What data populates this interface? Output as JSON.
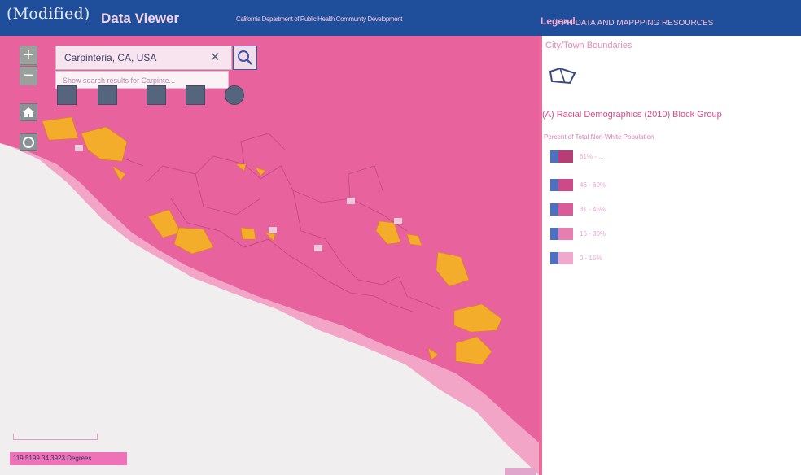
{
  "header": {
    "watermark": "(Modified)",
    "app_title": "Data Viewer",
    "agency": "California Department of Public Health Community Development",
    "legend_label": "Legend",
    "resources_label": "PH DATA AND MAPPPING RESOURCES"
  },
  "map": {
    "zoom_in_label": "+",
    "zoom_out_label": "−",
    "search": {
      "value": "Carpinteria, CA, USA",
      "clear_label": "✕",
      "suggestion": "Show search results for Carpinte..."
    },
    "coords_text": "119.5199 34.3923 Degrees"
  },
  "legend": {
    "city_layer": "City/Town Boundaries",
    "demographics_layer": "(A) Racial Demographics (2010) Block Group",
    "field_label": "Percent of Total Non-White Population",
    "classes": [
      {
        "label": "61% - ...",
        "color": "#b63d76"
      },
      {
        "label": "46 - 60%",
        "color": "#cd4a89"
      },
      {
        "label": "31 - 45%",
        "color": "#db5b98"
      },
      {
        "label": "16 - 30%",
        "color": "#e77eb2"
      },
      {
        "label": "0 - 15%",
        "color": "#f0a9cc"
      }
    ]
  },
  "colors": {
    "header_bg": "#1f4f9a",
    "map_fill": "#e8629d",
    "city_fill": "#f4ad2b",
    "panel_border": "#e86b9a"
  },
  "icons": {
    "home": "home-icon",
    "locate": "locate-icon",
    "search": "search-icon",
    "legend_polygon": "polygon-icon"
  }
}
